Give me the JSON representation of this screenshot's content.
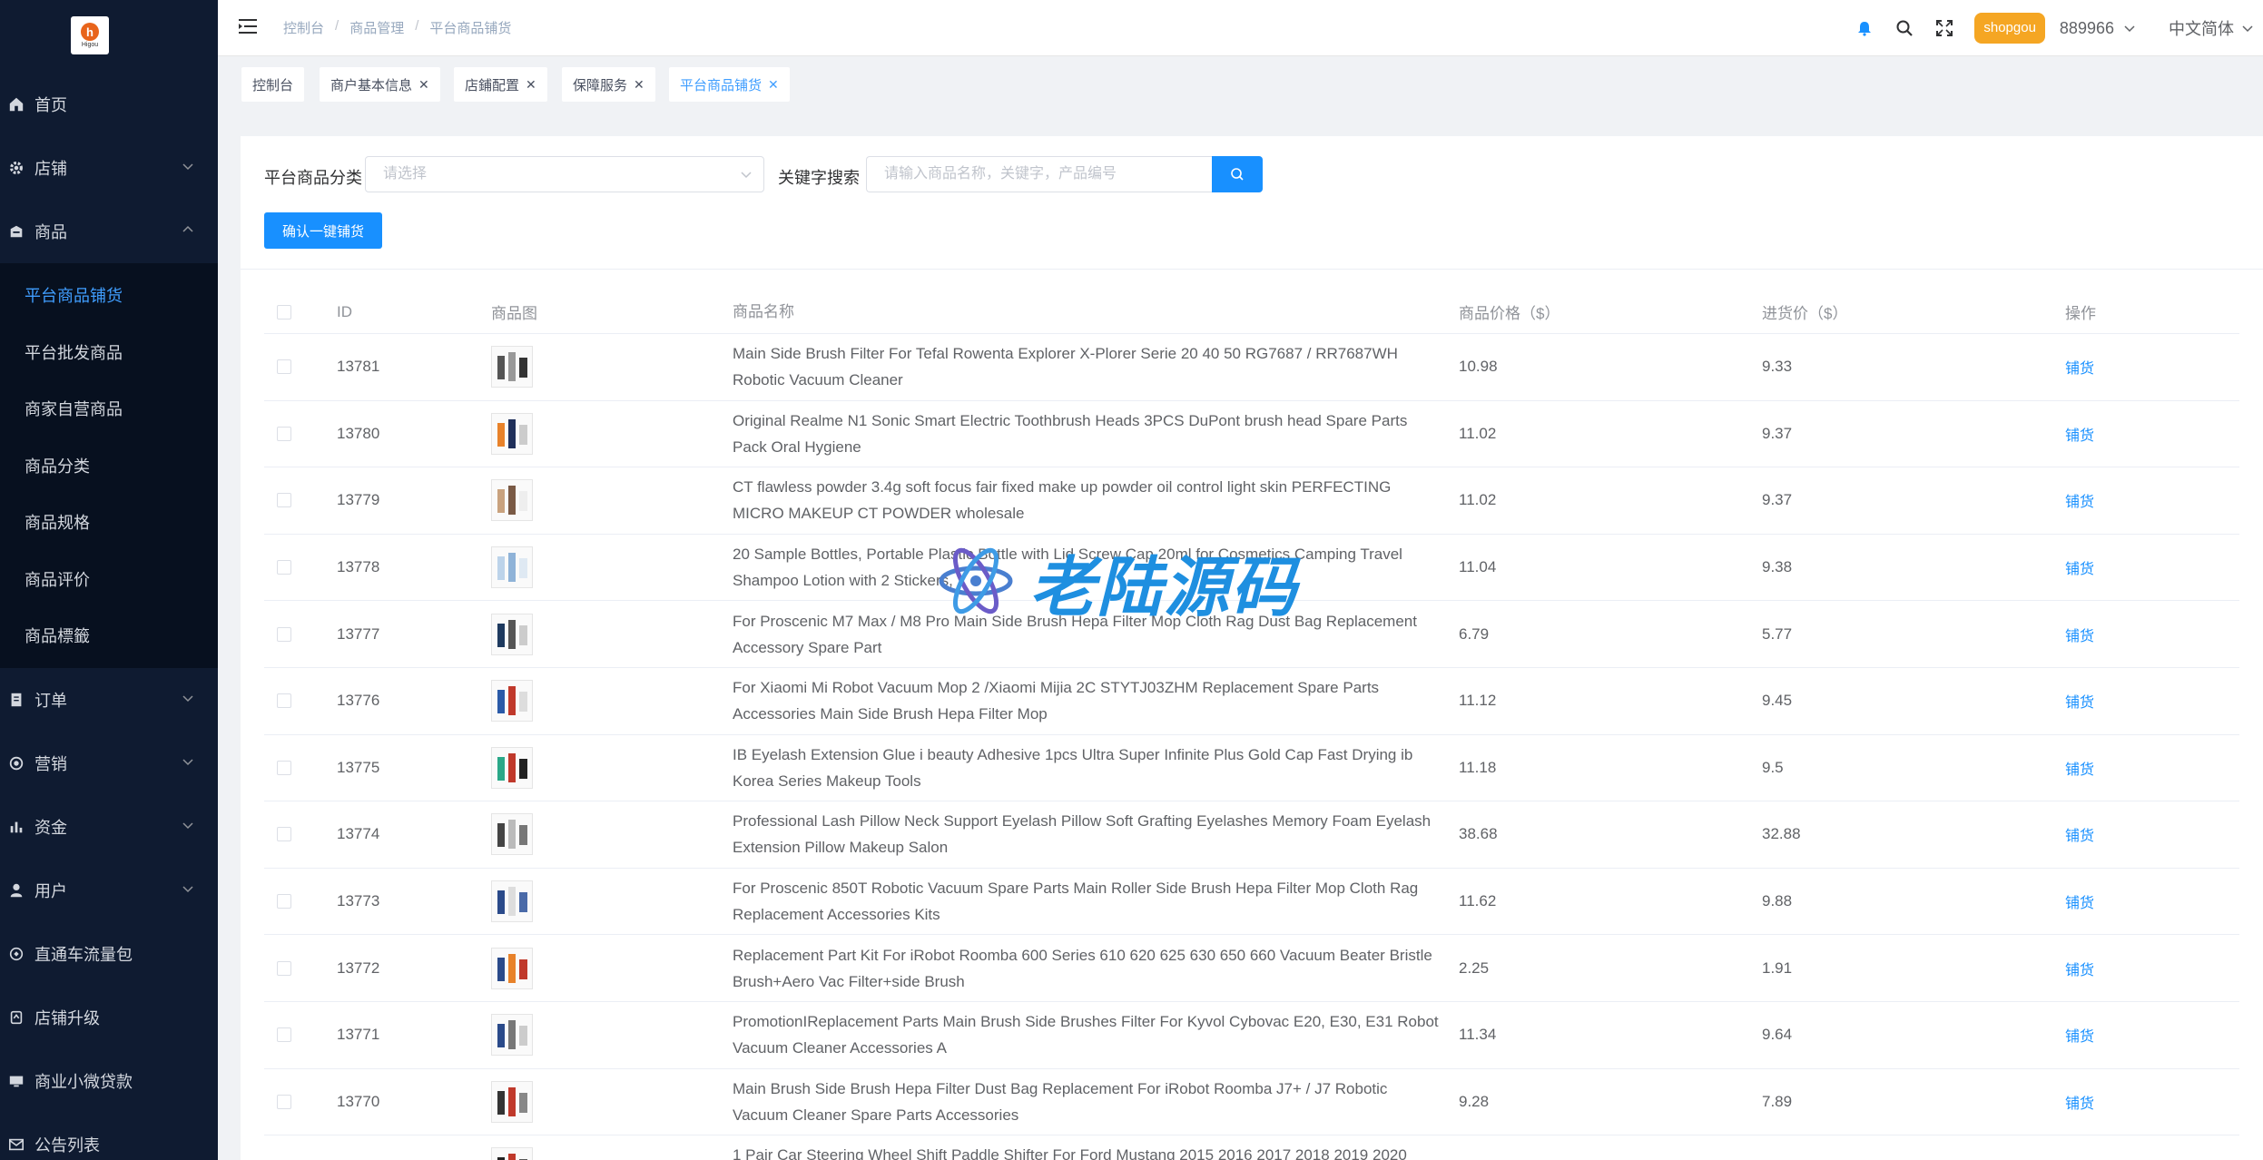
{
  "logo": {
    "text": "Higou"
  },
  "sidebar": {
    "items": [
      {
        "label": "首页",
        "icon": "home-icon"
      },
      {
        "label": "店铺",
        "icon": "gear-icon"
      },
      {
        "label": "商品",
        "icon": "shop-icon"
      },
      {
        "label": "订单",
        "icon": "document-icon"
      },
      {
        "label": "营销",
        "icon": "marketing-icon"
      },
      {
        "label": "资金",
        "icon": "bar-chart-icon"
      },
      {
        "label": "用户",
        "icon": "user-icon"
      },
      {
        "label": "直通车流量包",
        "icon": "traffic-icon"
      },
      {
        "label": "店铺升级",
        "icon": "upgrade-icon"
      },
      {
        "label": "商业小微贷款",
        "icon": "monitor-icon"
      },
      {
        "label": "公告列表",
        "icon": "mail-icon"
      }
    ],
    "submenu": [
      "平台商品铺货",
      "平台批发商品",
      "商家自营商品",
      "商品分类",
      "商品规格",
      "商品评价",
      "商品標籤"
    ]
  },
  "header": {
    "breadcrumb": [
      "控制台",
      "商品管理",
      "平台商品铺货"
    ],
    "shop_badge": "shopgou",
    "user_id": "889966",
    "language": "中文简体"
  },
  "tags": [
    "控制台",
    "商户基本信息",
    "店鋪配置",
    "保障服务",
    "平台商品铺货"
  ],
  "filter": {
    "category_label": "平台商品分类",
    "category_placeholder": "请选择",
    "keyword_label": "关键字搜索",
    "keyword_placeholder": "请输入商品名称，关键字，产品编号",
    "confirm_button": "确认一键铺货"
  },
  "table": {
    "columns": [
      "ID",
      "商品图",
      "商品名称",
      "商品价格（$）",
      "进货价（$）",
      "操作"
    ],
    "action_label": "铺货",
    "rows": [
      {
        "id": "13781",
        "name": "Main Side Brush Filter For Tefal Rowenta Explorer X-Plorer Serie 20 40 50 RG7687 / RR7687WH Robotic Vacuum Cleaner",
        "price": "10.98",
        "cost": "9.33"
      },
      {
        "id": "13780",
        "name": "Original Realme N1 Sonic Smart Electric Toothbrush Heads 3PCS DuPont brush head Spare Parts Pack Oral Hygiene",
        "price": "11.02",
        "cost": "9.37"
      },
      {
        "id": "13779",
        "name": "CT flawless powder 3.4g soft focus fair fixed make up powder oil control light skin PERFECTING MICRO MAKEUP CT POWDER wholesale",
        "price": "11.02",
        "cost": "9.37"
      },
      {
        "id": "13778",
        "name": "20 Sample Bottles, Portable Plastic Bottle with Lid Screw Cap 20ml for Cosmetics Camping Travel Shampoo Lotion with 2 Stickers,",
        "price": "11.04",
        "cost": "9.38"
      },
      {
        "id": "13777",
        "name": "For Proscenic M7 Max / M8 Pro Main Side Brush Hepa Filter Mop Cloth Rag Dust Bag Replacement Accessory Spare Part",
        "price": "6.79",
        "cost": "5.77"
      },
      {
        "id": "13776",
        "name": "For Xiaomi Mi Robot Vacuum Mop 2 /Xiaomi Mijia 2C STYTJ03ZHM Replacement Spare Parts Accessories Main Side Brush Hepa Filter Mop",
        "price": "11.12",
        "cost": "9.45"
      },
      {
        "id": "13775",
        "name": "IB Eyelash Extension Glue i beauty Adhesive 1pcs Ultra Super Infinite Plus Gold Cap Fast Drying ib Korea Series Makeup Tools",
        "price": "11.18",
        "cost": "9.5"
      },
      {
        "id": "13774",
        "name": "Professional Lash Pillow Neck Support Eyelash Pillow Soft Grafting Eyelashes Memory Foam Eyelash Extension Pillow Makeup Salon",
        "price": "38.68",
        "cost": "32.88"
      },
      {
        "id": "13773",
        "name": "For Proscenic 850T Robotic Vacuum Spare Parts Main Roller Side Brush Hepa Filter Mop Cloth Rag Replacement Accessories Kits",
        "price": "11.62",
        "cost": "9.88"
      },
      {
        "id": "13772",
        "name": "Replacement Part Kit For iRobot Roomba 600 Series 610 620 625 630 650 660 Vacuum Beater Bristle Brush+Aero Vac Filter+side Brush",
        "price": "2.25",
        "cost": "1.91"
      },
      {
        "id": "13771",
        "name": "PromotionIReplacement Parts Main Brush Side Brushes Filter For Kyvol Cybovac E20, E30, E31 Robot Vacuum Cleaner Accessories A",
        "price": "11.34",
        "cost": "9.64"
      },
      {
        "id": "13770",
        "name": "Main Brush Side Brush Hepa Filter Dust Bag Replacement For iRobot Roomba J7+ / J7 Robotic Vacuum Cleaner Spare Parts Accessories",
        "price": "9.28",
        "cost": "7.89"
      },
      {
        "id": "",
        "name": "1 Pair Car Steering Wheel Shift Paddle Shifter For Ford Mustang 2015 2016 2017 2018 2019 2020 Extensi",
        "price": "",
        "cost": ""
      }
    ]
  },
  "watermark": {
    "text": "老陆源码"
  },
  "colors": {
    "primary": "#1890ff",
    "sidebar_bg": "#0f1b31",
    "badge": "#f5a623"
  }
}
